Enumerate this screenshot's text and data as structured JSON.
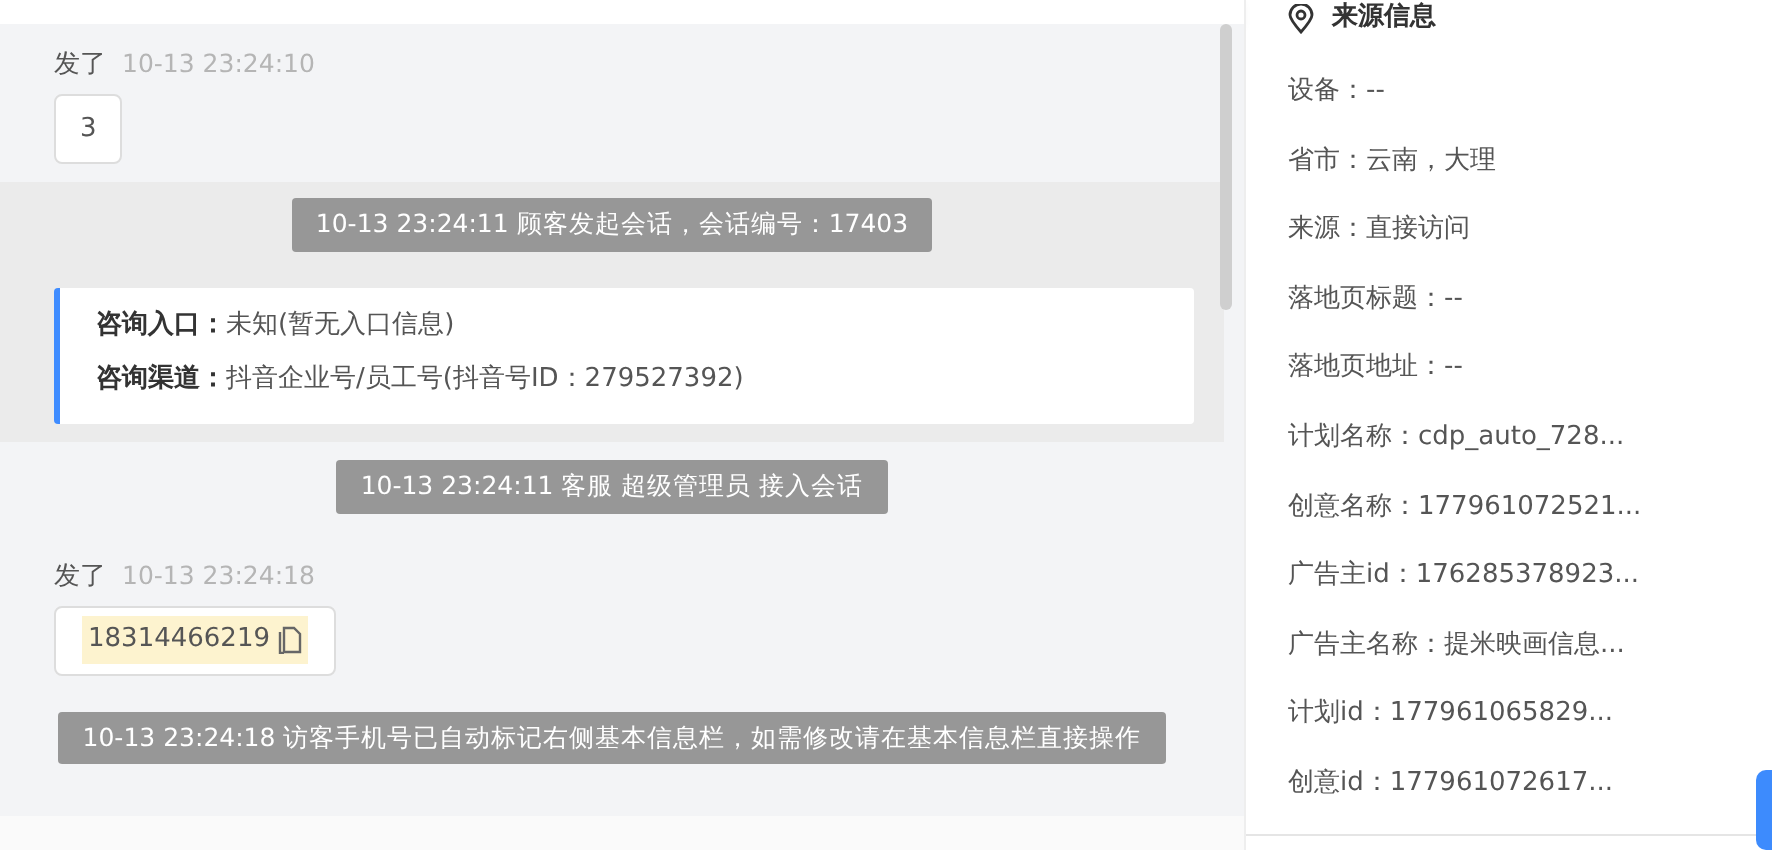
{
  "chat": {
    "items": [
      {
        "kind": "message",
        "label": "发了",
        "time": "10-13 23:24:10",
        "text": "3"
      },
      {
        "kind": "session",
        "highlighted": true,
        "notice": "10-13 23:24:11 顾客发起会话，会话编号：17403",
        "fields": [
          {
            "label": "咨询入口：",
            "value": "未知(暂无入口信息)"
          },
          {
            "label": "咨询渠道：",
            "value": "抖音企业号/员工号(抖音号ID：279527392)"
          }
        ]
      },
      {
        "kind": "notice",
        "text": "10-13 23:24:11 客服 超级管理员 接入会话"
      },
      {
        "kind": "phone",
        "label": "发了",
        "time": "10-13 23:24:18",
        "text": "18314466219"
      },
      {
        "kind": "notice",
        "text": "10-13 23:24:18 访客手机号已自动标记右侧基本信息栏，如需修改请在基本信息栏直接操作"
      }
    ]
  },
  "source_panel": {
    "title": "来源信息",
    "rows": [
      "设备：--",
      "省市：云南，大理",
      "来源：直接访问",
      "落地页标题：--",
      "落地页地址：--",
      "计划名称：cdp_auto_728...",
      "创意名称：177961072521...",
      "广告主id：176285378923...",
      "广告主名称：提米映画信息...",
      "计划id：177961065829...",
      "创意id：177961072617..."
    ]
  }
}
